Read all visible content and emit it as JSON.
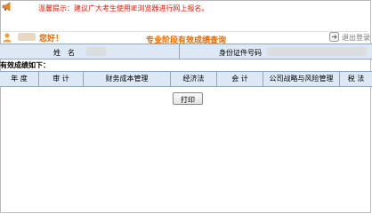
{
  "notice": {
    "text": "温馨提示：建议广大考生使用IE浏览器进行网上报名。",
    "color": "#d81e06"
  },
  "welcome": {
    "greeting": "您好！",
    "logout_label": "退出登录",
    "accent": "#e46b00"
  },
  "page": {
    "title": "专业阶段有效成绩查询"
  },
  "info": {
    "name_label": "姓　名",
    "id_label": "身份证件号码"
  },
  "scores": {
    "section_label": "有效成绩如下：",
    "columns": [
      "年 度",
      "审 计",
      "财务成本管理",
      "经济法",
      "会 计",
      "公司战略与风险管理",
      "税 法"
    ]
  },
  "actions": {
    "print_label": "打印"
  }
}
